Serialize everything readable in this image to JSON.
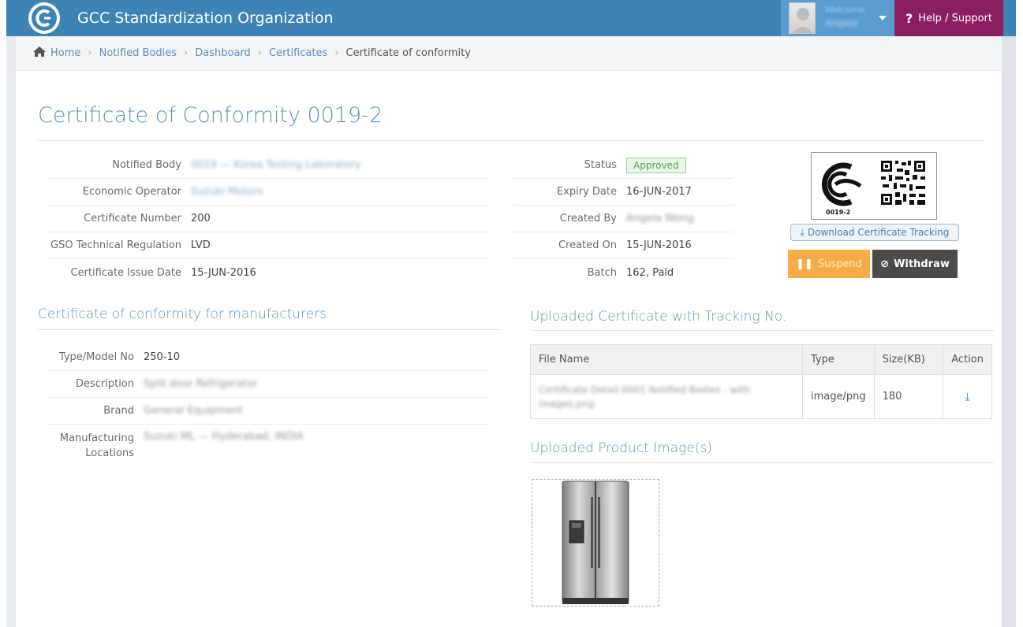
{
  "header": {
    "org_title": "GCC Standardization Organization",
    "welcome": "Welcome",
    "username": "Angela",
    "help": "Help / Support"
  },
  "breadcrumb": [
    "Home",
    "Notified Bodies",
    "Dashboard",
    "Certificates",
    "Certificate of conformity"
  ],
  "page_title": "Certificate of Conformity 0019-2",
  "details_left": [
    {
      "label": "Notified Body",
      "value": "0019 — Korea Testing Laboratory",
      "blurred": true
    },
    {
      "label": "Economic Operator",
      "value": "Suzuki Motors",
      "blurred": true
    },
    {
      "label": "Certificate Number",
      "value": "200",
      "blurred": false
    },
    {
      "label": "GSO Technical Regulation",
      "value": "LVD",
      "blurred": false
    },
    {
      "label": "Certificate Issue Date",
      "value": "15-JUN-2016",
      "blurred": false
    }
  ],
  "details_right": {
    "status_label": "Status",
    "status_value": "Approved",
    "expiry_label": "Expiry Date",
    "expiry_value": "16-JUN-2017",
    "created_by_label": "Created By",
    "created_by_value": "Angela Wong",
    "created_on_label": "Created On",
    "created_on_value": "15-JUN-2016",
    "batch_label": "Batch",
    "batch_value": "162, Paid"
  },
  "cert_image": {
    "number": "0019-2"
  },
  "actions": {
    "download": "Download Certificate Tracking",
    "suspend": "Suspend",
    "withdraw": "Withdraw"
  },
  "manufacturers": {
    "title": "Certificate of conformity for manufacturers",
    "rows": [
      {
        "label": "Type/Model No",
        "value": "250-10",
        "blurred": false
      },
      {
        "label": "Description",
        "value": "Split door Refrigerator",
        "blurred": true
      },
      {
        "label": "Brand",
        "value": "General Equipment",
        "blurred": true
      },
      {
        "label": "Manufacturing Locations",
        "value": "Suzuki ML — Hyderabad, INDIA",
        "blurred": true
      }
    ]
  },
  "uploaded_cert": {
    "title": "Uploaded Certificate with Tracking No.",
    "headers": [
      "File Name",
      "Type",
      "Size(KB)",
      "Action"
    ],
    "row": {
      "file_name": "Certificate Detail 0001 Notified Bodies - with images.png",
      "type": "image/png",
      "size": "180"
    }
  },
  "product_images": {
    "title": "Uploaded Product Image(s)"
  },
  "colors": {
    "accent": "#3d83b5",
    "help": "#8b1f60",
    "suspend": "#f6ad47",
    "withdraw": "#4b4b4b",
    "approved": "#5a9e56"
  }
}
